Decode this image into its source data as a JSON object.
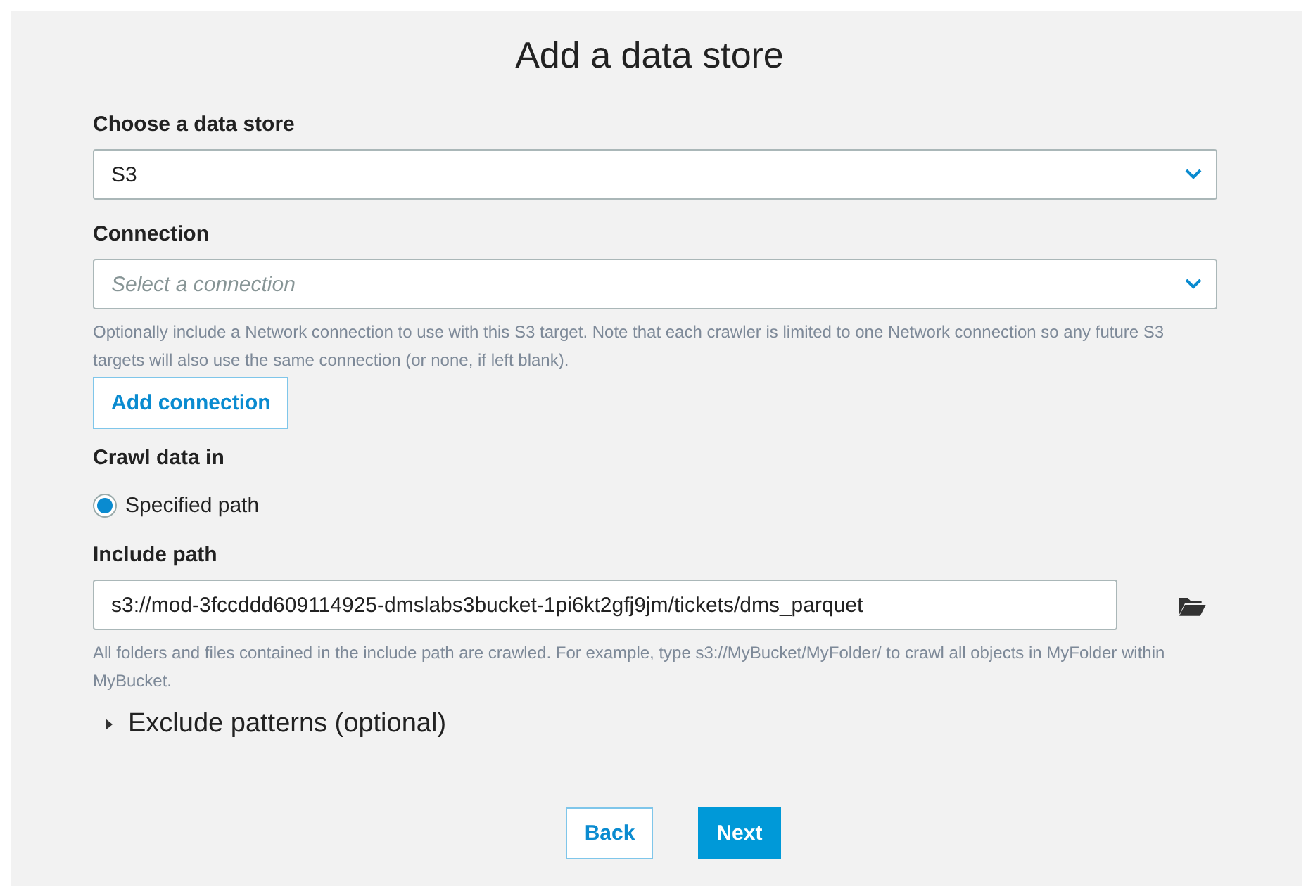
{
  "title": "Add a data store",
  "data_store": {
    "label": "Choose a data store",
    "value": "S3"
  },
  "connection": {
    "label": "Connection",
    "placeholder": "Select a connection",
    "help": "Optionally include a Network connection to use with this S3 target. Note that each crawler is limited to one Network connection so any future S3 targets will also use the same connection (or none, if left blank).",
    "button": "Add connection"
  },
  "crawl": {
    "label": "Crawl data in",
    "options": [
      {
        "label": "Specified path",
        "selected": true
      }
    ]
  },
  "include_path": {
    "label": "Include path",
    "value": "s3://mod-3fccddd609114925-dmslabs3bucket-1pi6kt2gfj9jm/tickets/dms_parquet",
    "help": "All folders and files contained in the include path are crawled. For example, type s3://MyBucket/MyFolder/ to crawl all objects in MyFolder within MyBucket."
  },
  "exclude": {
    "label": "Exclude patterns (optional)",
    "expanded": false
  },
  "buttons": [
    {
      "label": "Back",
      "kind": "secondary"
    },
    {
      "label": "Next",
      "kind": "primary"
    }
  ]
}
